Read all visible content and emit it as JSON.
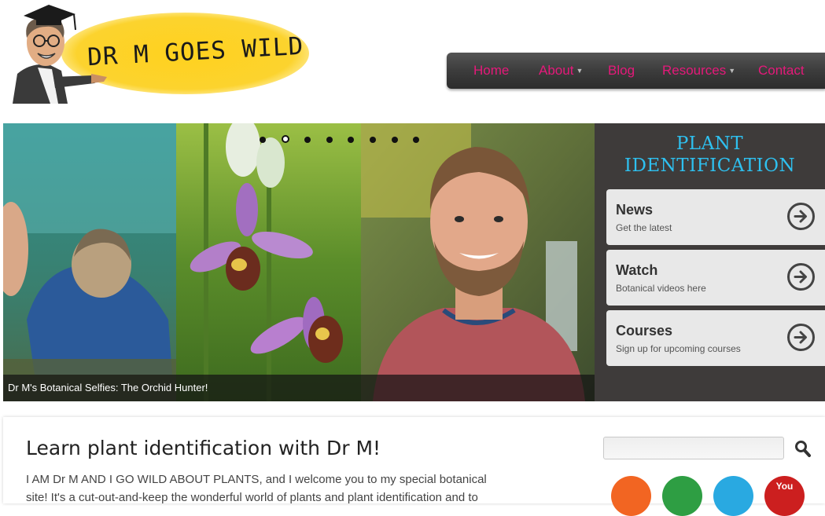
{
  "site": {
    "logo_text": "DR M GOES WILD"
  },
  "nav": {
    "items": [
      {
        "label": "Home",
        "dropdown": false
      },
      {
        "label": "About",
        "dropdown": true
      },
      {
        "label": "Blog",
        "dropdown": false
      },
      {
        "label": "Resources",
        "dropdown": true
      },
      {
        "label": "Contact",
        "dropdown": false
      }
    ]
  },
  "slider": {
    "caption": "Dr M's Botanical Selfies: The Orchid Hunter!",
    "slide_count": 8,
    "active_index": 1
  },
  "panel": {
    "title_line1": "PLANT",
    "title_line2": "IDENTIFICATION",
    "cards": [
      {
        "title": "News",
        "subtitle": "Get the latest"
      },
      {
        "title": "Watch",
        "subtitle": "Botanical videos here"
      },
      {
        "title": "Courses",
        "subtitle": "Sign up for upcoming courses"
      }
    ]
  },
  "content": {
    "title": "Learn plant identification with Dr M!",
    "intro_line1": "I AM Dr M AND I GO WILD ABOUT PLANTS, and I welcome you to my special botanical",
    "intro_line2": "site! It's a cut-out-and-keep the wonderful world of plants and plant identification and to"
  },
  "social": {
    "items": [
      {
        "name": "rss",
        "color": "#f26522"
      },
      {
        "name": "email",
        "color": "#2e9e43"
      },
      {
        "name": "twitter",
        "color": "#29a9e1"
      },
      {
        "name": "youtube",
        "color": "#cc1f1f",
        "label": "You"
      }
    ]
  },
  "colors": {
    "nav_text": "#e5197a",
    "panel_title": "#2ec0ef",
    "panel_bg": "#3e3b3a"
  }
}
